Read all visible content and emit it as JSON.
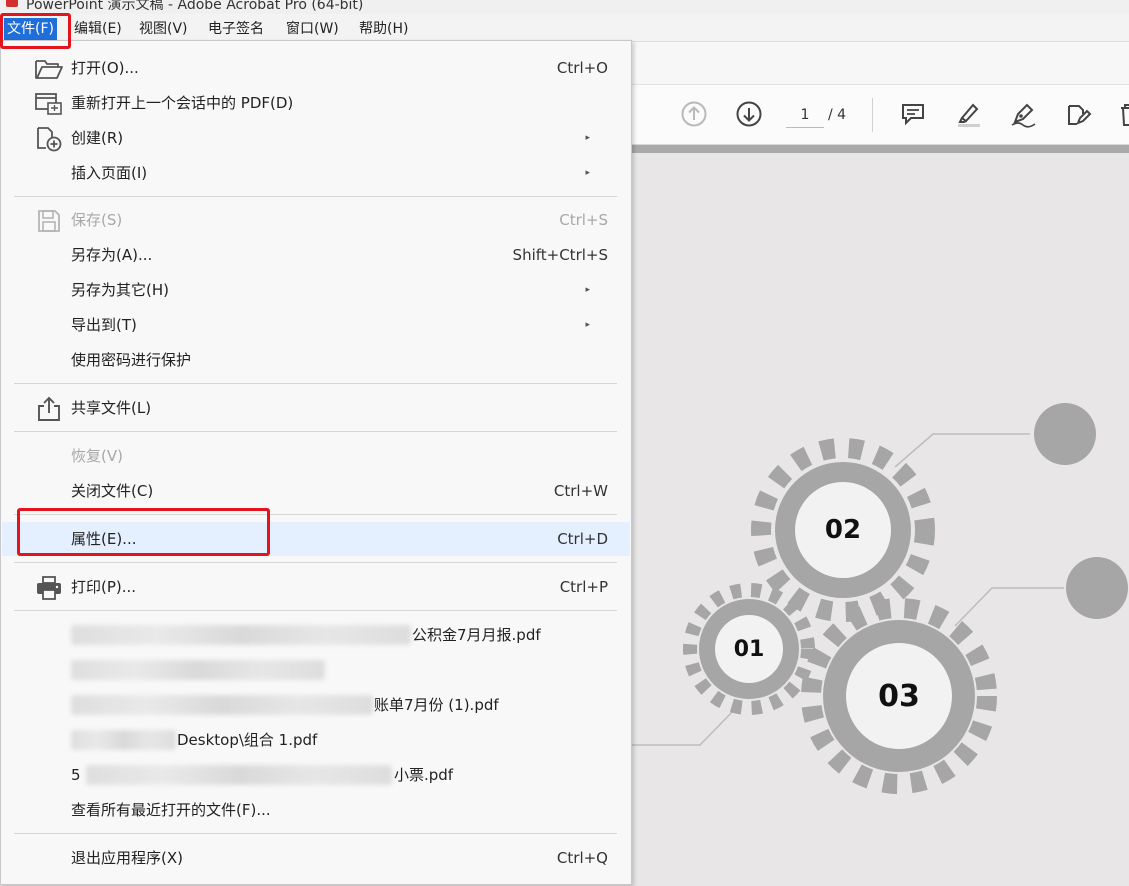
{
  "window": {
    "title": "PowerPoint 演示文稿 - Adobe Acrobat Pro (64-bit)"
  },
  "menubar": {
    "items": [
      {
        "label": "文件(F)",
        "active": true
      },
      {
        "label": "编辑(E)"
      },
      {
        "label": "视图(V)"
      },
      {
        "label": "电子签名"
      },
      {
        "label": "窗口(W)"
      },
      {
        "label": "帮助(H)"
      }
    ]
  },
  "toolbar": {
    "page_current": "1",
    "page_total": "/ 4"
  },
  "file_menu": {
    "items": [
      {
        "label": "打开(O)...",
        "shortcut": "Ctrl+O",
        "icon": "folder-open-icon"
      },
      {
        "label": "重新打开上一个会话中的 PDF(D)",
        "icon": "reopen-session-icon"
      },
      {
        "label": "创建(R)",
        "icon": "create-pdf-icon",
        "submenu": true
      },
      {
        "label": "插入页面(I)",
        "submenu": true
      },
      {
        "label": "保存(S)",
        "shortcut": "Ctrl+S",
        "icon": "save-icon",
        "disabled": true
      },
      {
        "label": "另存为(A)...",
        "shortcut": "Shift+Ctrl+S"
      },
      {
        "label": "另存为其它(H)",
        "submenu": true
      },
      {
        "label": "导出到(T)",
        "submenu": true
      },
      {
        "label": "使用密码进行保护"
      },
      {
        "label": "共享文件(L)",
        "icon": "share-icon"
      },
      {
        "label": "恢复(V)",
        "disabled": true
      },
      {
        "label": "关闭文件(C)",
        "shortcut": "Ctrl+W"
      },
      {
        "label": "属性(E)...",
        "shortcut": "Ctrl+D",
        "highlighted": true
      },
      {
        "label": "打印(P)...",
        "shortcut": "Ctrl+P",
        "icon": "print-icon"
      },
      {
        "label": "查看所有最近打开的文件(F)..."
      },
      {
        "label": "退出应用程序(X)",
        "shortcut": "Ctrl+Q"
      }
    ],
    "submenu_arrow": "▸",
    "recent_files": [
      {
        "visible_text": "公积金7月月报.pdf"
      },
      {
        "visible_text": ""
      },
      {
        "visible_text": "账单7月份 (1).pdf"
      },
      {
        "visible_text": "Desktop\\组合 1.pdf"
      },
      {
        "visible_text": "小票.pdf",
        "prefix": "5"
      }
    ]
  },
  "page_content": {
    "gears": [
      "01",
      "02",
      "03"
    ]
  },
  "colors": {
    "accent": "#1e6fd9",
    "highlight_box": "#e3141d",
    "hover": "#e4efff",
    "gear": "#a6a6a6"
  }
}
